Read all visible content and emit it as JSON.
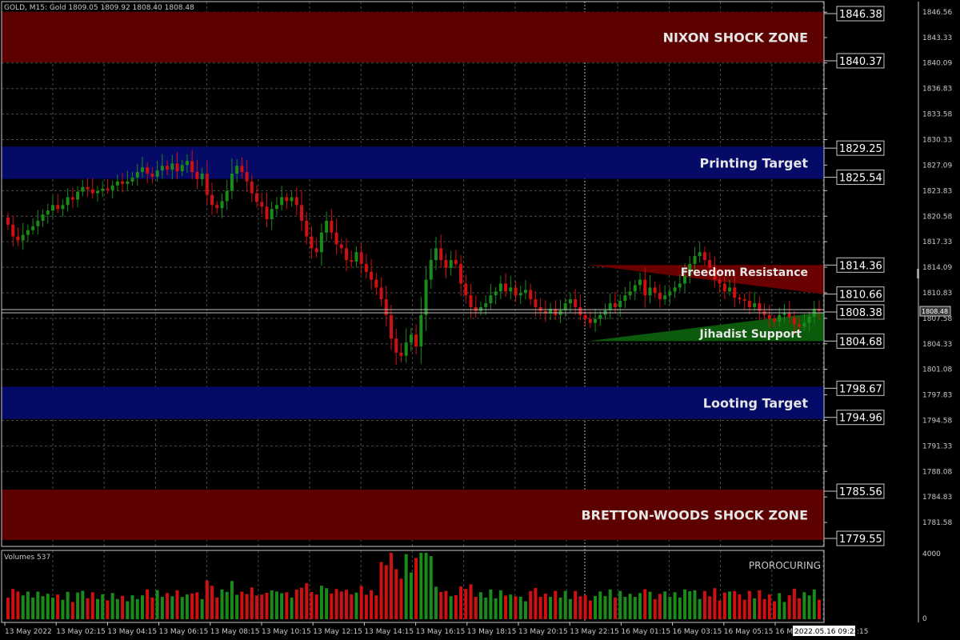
{
  "header": {
    "symbol_info": "GOLD, M15:  Gold  1809.05 1809.92 1808.40 1808.48"
  },
  "price_panel": {
    "ticks": [
      "1846.56",
      "1843.33",
      "1840.09",
      "1836.83",
      "1833.58",
      "1830.33",
      "1827.09",
      "1823.83",
      "1820.58",
      "1817.33",
      "1814.09",
      "1810.83",
      "1807.58",
      "1804.33",
      "1801.08",
      "1797.83",
      "1794.58",
      "1791.33",
      "1788.08",
      "1784.83",
      "1781.58"
    ],
    "current_price": "1808.48"
  },
  "zones": [
    {
      "name": "NIXON SHOCK ZONE",
      "top": 1846.38,
      "bottom": 1840.37,
      "top_label": "1846.38",
      "bottom_label": "1840.37",
      "color": "#5c0000"
    },
    {
      "name": "Printing Target",
      "top": 1829.25,
      "bottom": 1825.54,
      "top_label": "1829.25",
      "bottom_label": "1825.54",
      "color": "#050a66"
    },
    {
      "name": "Looting Target",
      "top": 1798.67,
      "bottom": 1794.96,
      "top_label": "1798.67",
      "bottom_label": "1794.96",
      "color": "#050a66"
    },
    {
      "name": "BRETTON-WOODS SHOCK ZONE",
      "top": 1785.56,
      "bottom": 1779.55,
      "top_label": "1785.56",
      "bottom_label": "1779.55",
      "color": "#5c0000"
    }
  ],
  "levels": {
    "freedom_resistance": {
      "name": "Freedom Resistance",
      "top": 1814.36,
      "bottom": 1810.66,
      "top_label": "1814.36",
      "bottom_label": "1810.66",
      "color": "#6b0000"
    },
    "jihadist_support": {
      "name": "Jihadist Support",
      "top": 1808.38,
      "bottom": 1804.68,
      "top_label": "1808.38",
      "bottom_label": "1804.68",
      "color": "#0c5a0c"
    }
  },
  "volume_panel": {
    "title": "Volumes 537",
    "indicator_label": "PROROCURING",
    "tick_top": "4000",
    "tick_bottom": "0"
  },
  "time_axis": {
    "labels": [
      "13 May 2022",
      "13 May 02:15",
      "13 May 04:15",
      "13 May 06:15",
      "13 May 08:15",
      "13 May 10:15",
      "13 May 12:15",
      "13 May 14:15",
      "13 May 16:15",
      "13 May 18:15",
      "13 May 20:15",
      "13 May 22:15",
      "16 May 01:15",
      "16 May 03:15",
      "16 May 05:15",
      "16 May"
    ],
    "cursor_time": "2022.05.16 09:22",
    "cursor_suffix": ":15"
  },
  "colors": {
    "bull": "#1a8a1a",
    "bear": "#d01010",
    "grid": "#4a4a4a",
    "axis_text": "#c8c8c8"
  },
  "chart_data": {
    "type": "candlestick",
    "symbol": "GOLD",
    "timeframe": "M15",
    "ylim": [
      1779.55,
      1848.0
    ],
    "closes": [
      1819.5,
      1818.0,
      1817.5,
      1818.2,
      1818.8,
      1819.3,
      1820.0,
      1820.8,
      1821.3,
      1822.0,
      1821.5,
      1822.0,
      1823.0,
      1822.7,
      1823.7,
      1824.3,
      1824.0,
      1823.5,
      1823.8,
      1824.1,
      1823.9,
      1824.5,
      1825.0,
      1824.7,
      1825.0,
      1825.5,
      1826.2,
      1826.8,
      1826.0,
      1825.6,
      1826.4,
      1827.0,
      1826.5,
      1827.3,
      1826.3,
      1827.1,
      1827.6,
      1826.2,
      1825.3,
      1826.0,
      1823.3,
      1822.0,
      1821.6,
      1822.5,
      1823.8,
      1826.0,
      1827.0,
      1826.2,
      1825.0,
      1823.5,
      1822.4,
      1821.8,
      1820.2,
      1821.5,
      1822.0,
      1823.0,
      1822.5,
      1823.0,
      1822.0,
      1820.0,
      1818.0,
      1816.5,
      1816.0,
      1818.5,
      1820.0,
      1818.5,
      1817.0,
      1816.5,
      1815.0,
      1814.8,
      1816.0,
      1814.5,
      1813.5,
      1812.5,
      1811.5,
      1810.0,
      1808.0,
      1805.0,
      1803.2,
      1802.8,
      1804.5,
      1805.5,
      1804.0,
      1808.0,
      1812.5,
      1815.0,
      1816.5,
      1815.0,
      1814.0,
      1815.0,
      1814.5,
      1812.0,
      1810.5,
      1809.0,
      1808.5,
      1809.0,
      1809.5,
      1810.5,
      1811.0,
      1812.0,
      1811.0,
      1811.5,
      1810.5,
      1810.8,
      1811.2,
      1810.0,
      1809.0,
      1808.5,
      1808.2,
      1808.8,
      1808.0,
      1808.6,
      1809.5,
      1810.0,
      1809.0,
      1808.0,
      1807.5,
      1807.0,
      1807.5,
      1808.0,
      1808.6,
      1809.5,
      1809.0,
      1809.8,
      1810.5,
      1811.0,
      1811.8,
      1812.5,
      1810.5,
      1811.5,
      1810.8,
      1810.0,
      1810.5,
      1811.0,
      1811.5,
      1812.0,
      1813.0,
      1814.5,
      1815.5,
      1816.0,
      1815.0,
      1814.0,
      1812.5,
      1812.0,
      1811.0,
      1811.5,
      1810.2,
      1810.0,
      1809.8,
      1809.0,
      1809.5,
      1808.5,
      1808.0,
      1807.5,
      1807.2,
      1808.0,
      1808.3,
      1807.7,
      1806.8,
      1806.5,
      1807.0,
      1807.8,
      1808.8,
      1808.5
    ]
  }
}
